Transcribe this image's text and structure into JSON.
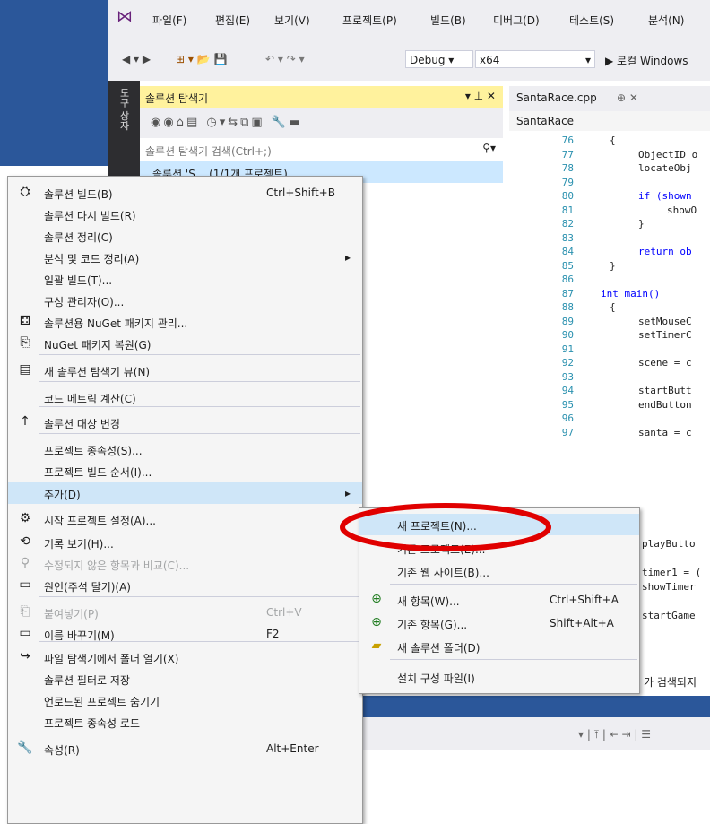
{
  "menubar": {
    "items": [
      "파일(F)",
      "편집(E)",
      "보기(V)",
      "프로젝트(P)",
      "빌드(B)",
      "디버그(D)",
      "테스트(S)",
      "분석(N)"
    ]
  },
  "toolbar": {
    "config": "Debug",
    "platform": "x64",
    "run_label": "▶ 로컬 Windows"
  },
  "side_tabs": [
    "도구 상자"
  ],
  "solution_explorer": {
    "title": "솔루션 탐색기",
    "search_placeholder": "솔루션 탐색기 검색(Ctrl+;)",
    "row_text": "솔루션 'S... (1/1개 프로젝트)"
  },
  "editor": {
    "tab": "SantaRace.cpp",
    "nav": "SantaRace",
    "line_numbers": [
      "76",
      "77",
      "78",
      "79",
      "80",
      "81",
      "82",
      "83",
      "84",
      "85",
      "86",
      "87",
      "88",
      "89",
      "90",
      "91",
      "92",
      "93",
      "94",
      "95",
      "96",
      "97"
    ],
    "code_lines": [
      "{",
      "ObjectID o",
      "locateObj",
      "",
      "if (shown",
      "showO",
      "}",
      "",
      "return ob",
      "}",
      "",
      "int main()",
      "{",
      "setMouseC",
      "setTimerC",
      "",
      "scene = c",
      "",
      "startButt",
      "endButton",
      "",
      "santa = c"
    ],
    "extra_code": [
      "playButto",
      "",
      "timer1 = (",
      "showTimer",
      "",
      "startGame"
    ],
    "status": "가 검색되지"
  },
  "context_menu": {
    "items": [
      {
        "icon": "build-icon",
        "label": "솔루션 빌드(B)",
        "shortcut": "Ctrl+Shift+B"
      },
      {
        "icon": "",
        "label": "솔루션 다시 빌드(R)",
        "shortcut": ""
      },
      {
        "icon": "",
        "label": "솔루션 정리(C)",
        "shortcut": ""
      },
      {
        "icon": "",
        "label": "분석 및 코드 정리(A)",
        "shortcut": "▸"
      },
      {
        "icon": "",
        "label": "일괄 빌드(T)...",
        "shortcut": ""
      },
      {
        "icon": "",
        "label": "구성 관리자(O)...",
        "shortcut": ""
      },
      {
        "icon": "nuget-icon",
        "label": "솔루션용 NuGet 패키지 관리...",
        "shortcut": ""
      },
      {
        "icon": "restore-icon",
        "label": "NuGet 패키지 복원(G)",
        "shortcut": ""
      },
      {
        "icon": "explorer-view-icon",
        "label": "새 솔루션 탐색기 뷰(N)",
        "shortcut": ""
      },
      {
        "icon": "",
        "label": "코드 메트릭 계산(C)",
        "shortcut": ""
      },
      {
        "icon": "arrow-up-icon",
        "label": "솔루션 대상 변경",
        "shortcut": ""
      },
      {
        "icon": "",
        "label": "프로젝트 종속성(S)...",
        "shortcut": ""
      },
      {
        "icon": "",
        "label": "프로젝트 빌드 순서(I)...",
        "shortcut": ""
      },
      {
        "icon": "",
        "label": "추가(D)",
        "shortcut": "▸"
      },
      {
        "icon": "gear-icon",
        "label": "시작 프로젝트 설정(A)...",
        "shortcut": ""
      },
      {
        "icon": "history-icon",
        "label": "기록 보기(H)...",
        "shortcut": ""
      },
      {
        "icon": "compare-icon",
        "label": "수정되지 않은 항목과 비교(C)...",
        "shortcut": ""
      },
      {
        "icon": "comment-icon",
        "label": "원인(주석 달기)(A)",
        "shortcut": ""
      },
      {
        "icon": "paste-icon",
        "label": "붙여넣기(P)",
        "shortcut": "Ctrl+V"
      },
      {
        "icon": "rename-icon",
        "label": "이름 바꾸기(M)",
        "shortcut": "F2"
      },
      {
        "icon": "open-folder-icon",
        "label": "파일 탐색기에서 폴더 열기(X)",
        "shortcut": ""
      },
      {
        "icon": "",
        "label": "솔루션 필터로 저장",
        "shortcut": ""
      },
      {
        "icon": "",
        "label": "언로드된 프로젝트 숨기기",
        "shortcut": ""
      },
      {
        "icon": "",
        "label": "프로젝트 종속성 로드",
        "shortcut": ""
      },
      {
        "icon": "wrench-icon",
        "label": "속성(R)",
        "shortcut": "Alt+Enter"
      }
    ]
  },
  "submenu": {
    "items": [
      {
        "icon": "",
        "label": "새 프로젝트(N)...",
        "shortcut": ""
      },
      {
        "icon": "",
        "label": "기존 프로젝트(E)...",
        "shortcut": ""
      },
      {
        "icon": "",
        "label": "기존 웹 사이트(B)...",
        "shortcut": ""
      },
      {
        "icon": "new-item-icon",
        "label": "새 항목(W)...",
        "shortcut": "Ctrl+Shift+A"
      },
      {
        "icon": "existing-item-icon",
        "label": "기존 항목(G)...",
        "shortcut": "Shift+Alt+A"
      },
      {
        "icon": "new-folder-icon",
        "label": "새 솔루션 폴더(D)",
        "shortcut": ""
      },
      {
        "icon": "",
        "label": "설치 구성 파일(I)",
        "shortcut": ""
      }
    ]
  },
  "colors": {
    "highlight_circle": "#e00000",
    "accent": "#2b579a",
    "menu_hover": "#cfe6f8"
  }
}
